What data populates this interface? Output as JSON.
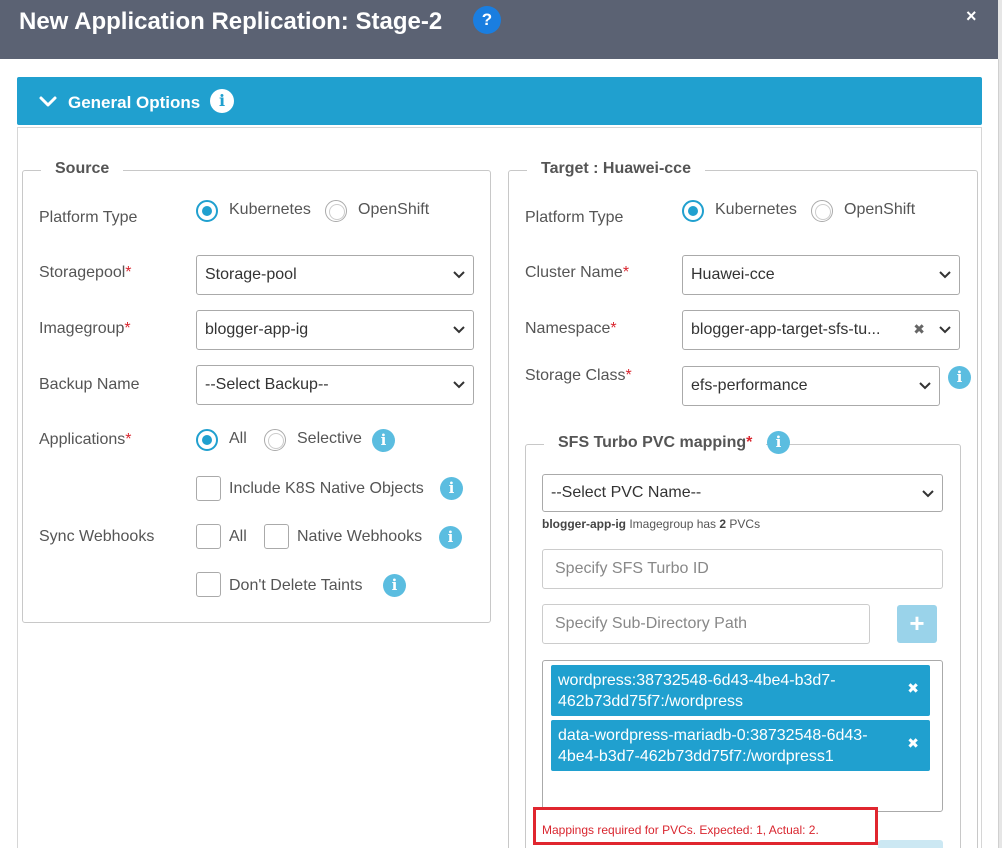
{
  "dialog": {
    "title": "New Application Replication: Stage-2",
    "help_label": "?",
    "close_label": "×"
  },
  "panel": {
    "title": "General Options",
    "info_label": "i"
  },
  "source": {
    "legend": "Source",
    "platform_type_label": "Platform Type",
    "platform_options": [
      "Kubernetes",
      "OpenShift"
    ],
    "platform_selected": "Kubernetes",
    "storagepool_label": "Storagepool",
    "storagepool_value": "Storage-pool",
    "imagegroup_label": "Imagegroup",
    "imagegroup_value": "blogger-app-ig",
    "backup_label": "Backup Name",
    "backup_value": "--Select Backup--",
    "applications_label": "Applications",
    "applications_options": [
      "All",
      "Selective"
    ],
    "applications_selected": "All",
    "include_k8s_label": "Include K8S Native Objects",
    "sync_webhooks_label": "Sync Webhooks",
    "webhook_all_label": "All",
    "webhook_native_label": "Native Webhooks",
    "dont_delete_taints_label": "Don't Delete Taints",
    "required_mark": "*"
  },
  "target": {
    "legend": "Target : Huawei-cce",
    "platform_type_label": "Platform Type",
    "platform_options": [
      "Kubernetes",
      "OpenShift"
    ],
    "platform_selected": "Kubernetes",
    "cluster_label": "Cluster Name",
    "cluster_value": "Huawei-cce",
    "namespace_label": "Namespace",
    "namespace_value": "blogger-app-target-sfs-tu...",
    "namespace_clear": "✖",
    "storage_class_label": "Storage Class",
    "storage_class_value": "efs-performance",
    "required_mark": "*"
  },
  "sfs": {
    "legend": "SFS Turbo PVC mapping",
    "pvc_select_value": "--Select PVC Name--",
    "hint_ig": "blogger-app-ig",
    "hint_mid": " Imagegroup has ",
    "hint_count": "2",
    "hint_tail": " PVCs",
    "turbo_id_placeholder": "Specify SFS Turbo ID",
    "subdir_placeholder": "Specify Sub-Directory Path",
    "add_label": "+",
    "mappings": [
      "wordpress:38732548-6d43-4be4-b3d7-\n462b73dd75f7:/wordpress",
      "data-wordpress-mariadb-0:38732548-6d43-\n4be4-b3d7-462b73dd75f7:/wordpress1"
    ],
    "remove_label": "✖",
    "error": "Mappings required for PVCs. Expected: 1, Actual: 2."
  },
  "colors": {
    "titlebar": "#5b6273",
    "accent": "#20a0cf",
    "error": "#d9262f"
  }
}
